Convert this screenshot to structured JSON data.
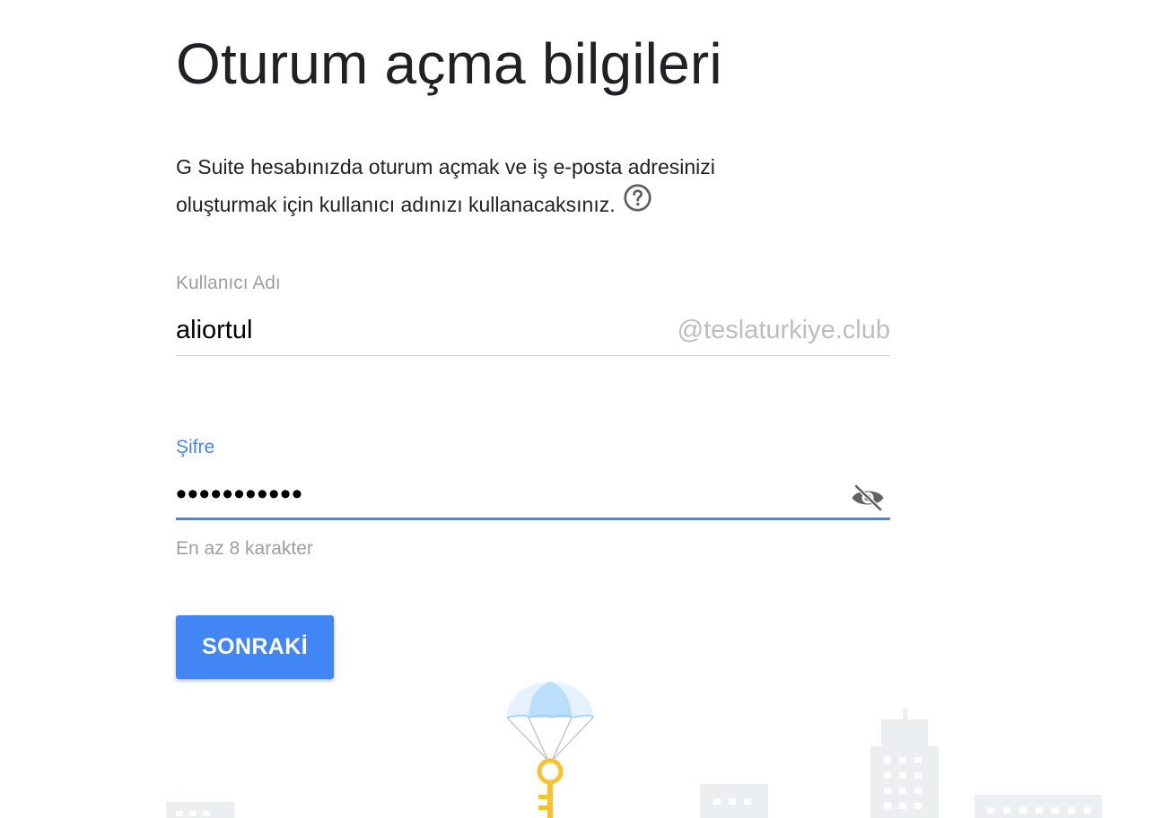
{
  "page_title": "Oturum açma bilgileri",
  "description": {
    "line1": "G Suite hesabınızda oturum açmak ve iş e-posta adresinizi",
    "line2": "oluşturmak için kullanıcı adınızı kullanacaksınız."
  },
  "username": {
    "label": "Kullanıcı Adı",
    "value": "aliortul",
    "domain_suffix": "@teslaturkiye.club"
  },
  "password": {
    "label": "Şifre",
    "masked_value": "•••••••••••",
    "hint": "En az 8 karakter"
  },
  "buttons": {
    "next_label": "SONRAKİ"
  },
  "icons": {
    "help": "help-circle-icon",
    "visibility": "visibility-off-icon",
    "illustration": "parachute-key-illustration"
  },
  "colors": {
    "accent": "#4285f4",
    "key": "#fbc02d",
    "buildings": "#eceff1"
  }
}
